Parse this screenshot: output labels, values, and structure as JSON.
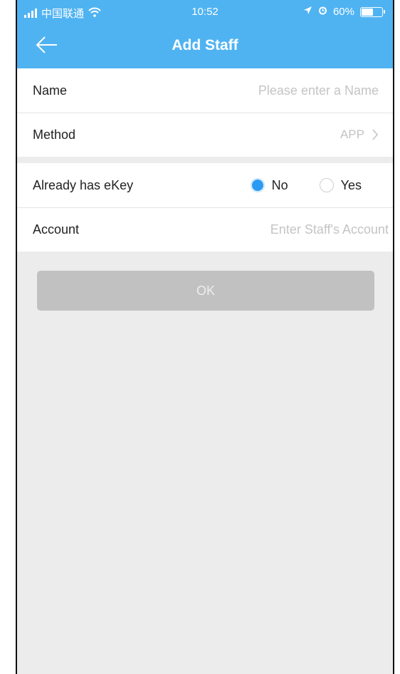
{
  "status": {
    "carrier": "中国联通",
    "time": "10:52",
    "battery": "60%",
    "battery_level": 0.6
  },
  "nav": {
    "title": "Add Staff"
  },
  "form": {
    "name_label": "Name",
    "name_placeholder": "Please enter a Name",
    "method_label": "Method",
    "method_value": "APP",
    "ekey_label": "Already has eKey",
    "option_no": "No",
    "option_yes": "Yes",
    "selected": "No",
    "account_label": "Account",
    "account_placeholder": "Enter Staff's Account"
  },
  "ok_label": "OK"
}
